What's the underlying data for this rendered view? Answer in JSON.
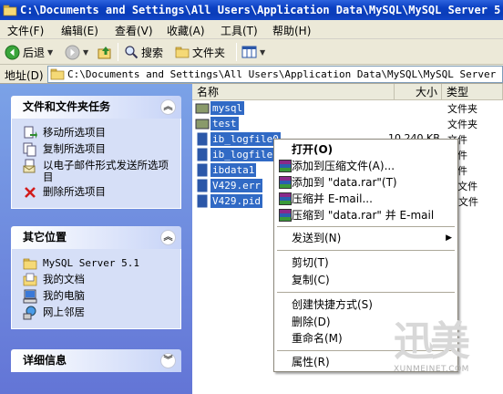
{
  "window": {
    "title": "C:\\Documents and Settings\\All Users\\Application Data\\MySQL\\MySQL Server 5.1\\"
  },
  "menubar": {
    "items": [
      "文件(F)",
      "编辑(E)",
      "查看(V)",
      "收藏(A)",
      "工具(T)",
      "帮助(H)"
    ]
  },
  "toolbar": {
    "back_label": "后退",
    "search_label": "搜索",
    "folders_label": "文件夹"
  },
  "address": {
    "label": "地址(D)",
    "value": "C:\\Documents and Settings\\All Users\\Application Data\\MySQL\\MySQL Server 5.1\\data"
  },
  "tasks": {
    "file_tasks": {
      "title": "文件和文件夹任务",
      "items": [
        "移动所选项目",
        "复制所选项目",
        "以电子邮件形式发送所选项目",
        "删除所选项目"
      ]
    },
    "other_places": {
      "title": "其它位置",
      "items": [
        "MySQL Server 5.1",
        "我的文档",
        "我的电脑",
        "网上邻居"
      ]
    },
    "details": {
      "title": "详细信息"
    }
  },
  "filelist": {
    "columns": [
      "名称",
      "大小",
      "类型"
    ],
    "rows": [
      {
        "name": "mysql",
        "size": "",
        "type": "文件夹"
      },
      {
        "name": "test",
        "size": "",
        "type": "文件夹"
      },
      {
        "name": "ib_logfile0",
        "size": "",
        "type": "文件"
      },
      {
        "name": "ib_logfile1",
        "size": "",
        "type": "文件"
      },
      {
        "name": "ibdata1",
        "size": "",
        "type": "文件"
      },
      {
        "name": "V429.err",
        "size": "",
        "type": "R 文件"
      },
      {
        "name": "V429.pid",
        "size": "",
        "type": "D 文件"
      }
    ],
    "partial_size": "10,240 KB"
  },
  "context_menu": {
    "items": [
      {
        "label": "打开(O)"
      },
      {
        "label": "添加到压缩文件(A)..."
      },
      {
        "label": "添加到 \"data.rar\"(T)"
      },
      {
        "label": "压缩并 E-mail..."
      },
      {
        "label": "压缩到 \"data.rar\" 并 E-mail"
      },
      {
        "label": "发送到(N)"
      },
      {
        "label": "剪切(T)"
      },
      {
        "label": "复制(C)"
      },
      {
        "label": "创建快捷方式(S)"
      },
      {
        "label": "删除(D)"
      },
      {
        "label": "重命名(M)"
      },
      {
        "label": "属性(R)"
      }
    ]
  },
  "watermark": {
    "big": "迅美",
    "sub": "XUNMEINET.COM"
  },
  "colors": {
    "title_bar": "#0a3fc1",
    "selection": "#316ac5",
    "task_pane": "#7ba2e7"
  }
}
